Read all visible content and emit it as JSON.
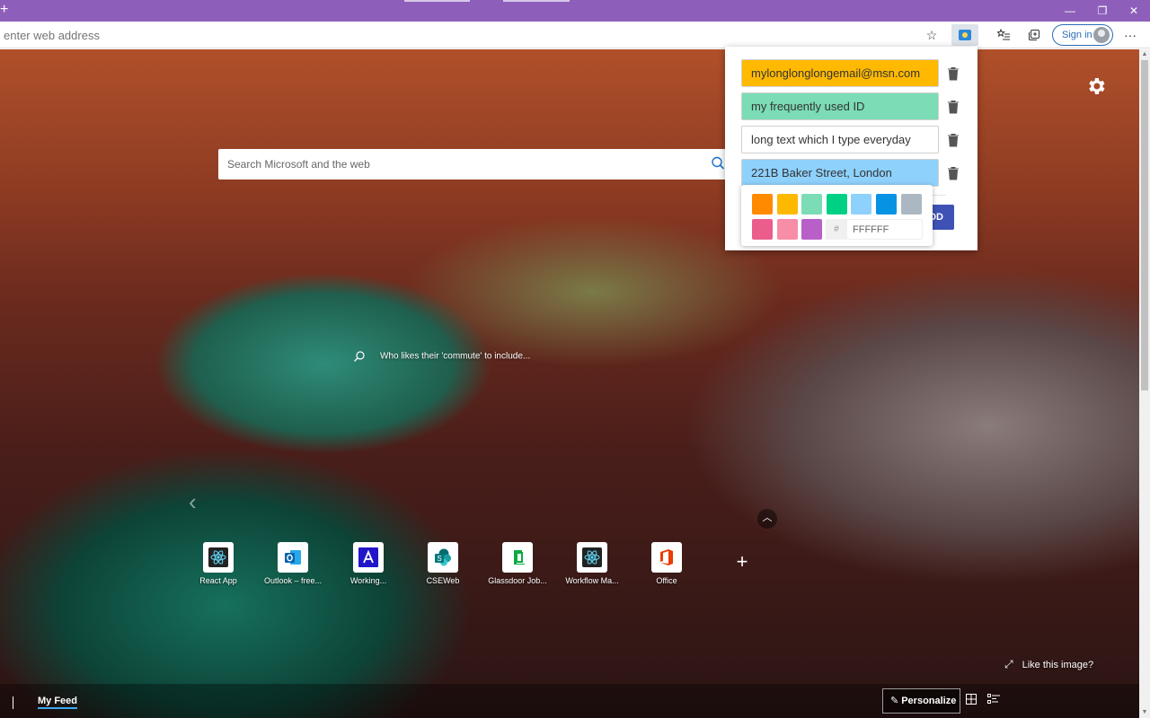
{
  "browser": {
    "new_tab_icon": "plus-icon",
    "window_controls": {
      "minimize": "—",
      "restore": "❐",
      "close": "✕"
    },
    "address_bar": {
      "placeholder": "enter web address"
    },
    "toolbar": {
      "favorite_icon": "star-icon",
      "extension_icon": "clipboard-extension-icon",
      "favorites_icon": "favorites-list-icon",
      "collections_icon": "collections-icon",
      "signin_label": "Sign in",
      "more_icon": "ellipsis-icon"
    },
    "theme_color": "#8e5fba"
  },
  "newtab": {
    "search": {
      "placeholder": "Search Microsoft and the web"
    },
    "image_info": "Who likes their 'commute' to include...",
    "quick_links": [
      {
        "label": "React App",
        "icon": "react-icon"
      },
      {
        "label": "Outlook – free...",
        "icon": "outlook-icon"
      },
      {
        "label": "Working...",
        "icon": "azure-a-icon"
      },
      {
        "label": "CSEWeb",
        "icon": "sharepoint-icon"
      },
      {
        "label": "Glassdoor Job...",
        "icon": "glassdoor-icon"
      },
      {
        "label": "Workflow Ma...",
        "icon": "react-icon"
      },
      {
        "label": "Office",
        "icon": "office-icon"
      }
    ],
    "like_image": "Like this image?",
    "bottom": {
      "feed_tab": "My Feed",
      "personalize_label": "Personalize"
    }
  },
  "extension_popup": {
    "entries": [
      {
        "text": "mylonglonglongemail@msn.com",
        "color": "#ffb900"
      },
      {
        "text": "my frequently used ID",
        "color": "#7bdcb5"
      },
      {
        "text": "long text which I type everyday",
        "color": "#ffffff"
      },
      {
        "text": "221B Baker Street, London",
        "color": "#8ed1fc"
      }
    ],
    "add_label": "ADD",
    "color_picker": {
      "swatches": [
        "#ff8a00",
        "#fcb900",
        "#7bdcb5",
        "#00d084",
        "#8ed1fc",
        "#0693e3",
        "#abb8c3",
        "#eb5e8c",
        "#f78da7",
        "#b95fc8"
      ],
      "hash": "#",
      "hex_value": "FFFFFF"
    }
  }
}
